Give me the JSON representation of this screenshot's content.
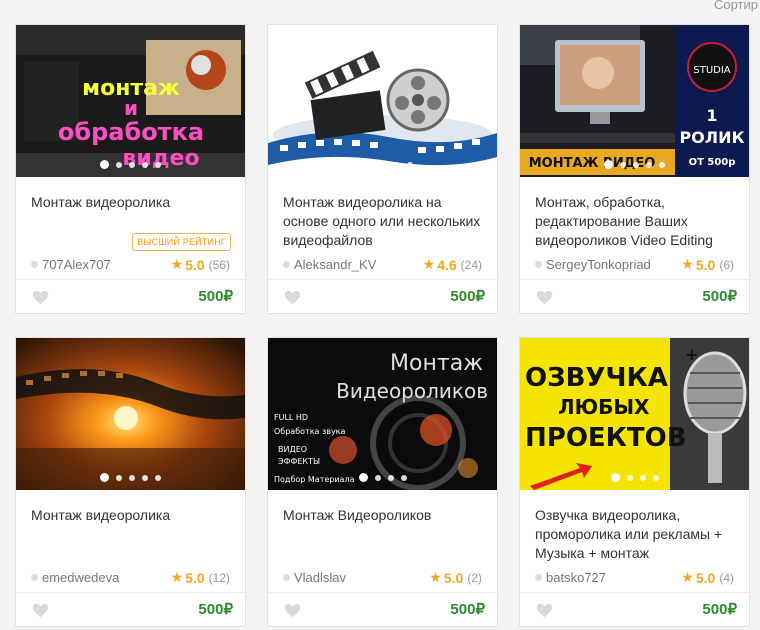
{
  "header": {
    "sort_label": "Сортир"
  },
  "cards": [
    {
      "title": "Монтаж видеоролика",
      "badge": "ВЫСШИЙ РЕЙТИНГ",
      "seller": "707Alex707",
      "rating": "5.0",
      "reviews": "(56)",
      "price": "500₽",
      "image": {
        "line1": "монтаж",
        "line2": "и",
        "line3": "обработка",
        "line4": "видео"
      }
    },
    {
      "title": "Монтаж видеоролика на основе одного или нескольких видеофайлов",
      "seller": "Aleksandr_KV",
      "rating": "4.6",
      "reviews": "(24)",
      "price": "500₽"
    },
    {
      "title": "Монтаж, обработка, редактирование Ваших видеороликов Video Editing",
      "seller": "SergeyTonkopriad",
      "rating": "5.0",
      "reviews": "(6)",
      "price": "500₽",
      "image": {
        "badge": "STUDIA",
        "num": "1",
        "word": "РОЛИК",
        "price": "ОТ 500р",
        "strip": "МОНТАЖ ВИДЕО"
      }
    },
    {
      "title": "Монтаж видеоролика",
      "seller": "emedwedeva",
      "rating": "5.0",
      "reviews": "(12)",
      "price": "500₽"
    },
    {
      "title": "Монтаж Видеороликов",
      "seller": "Vladlslav",
      "rating": "5.0",
      "reviews": "(2)",
      "price": "500₽",
      "image": {
        "line1": "Монтаж",
        "line2": "Видеороликов",
        "f1": "FULL HD",
        "f2": "Обработка звука",
        "f3": "ВИДЕО",
        "f4": "ЭФФЕКТЫ",
        "f5": "Подбор Материала"
      }
    },
    {
      "title": "Озвучка видеоролика, проморолика или рекламы + Музыка + монтаж",
      "seller": "batsko727",
      "rating": "5.0",
      "reviews": "(4)",
      "price": "500₽",
      "image": {
        "line1": "ОЗВУЧКА",
        "line2": "ЛЮБЫХ",
        "line3": "ПРОЕКТОВ",
        "plus": "+"
      }
    }
  ],
  "colors": {
    "price": "#2e8b2e",
    "star": "#f5a623",
    "badge": "#f39c12"
  }
}
